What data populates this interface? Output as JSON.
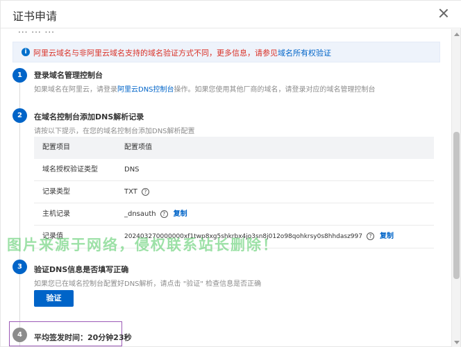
{
  "dialog": {
    "title": "证书申请"
  },
  "cut_text": "... ...    ...",
  "alert": {
    "text": "阿里云域名与非阿里云域名支持的域名验证方式不同，更多信息，请参见",
    "link": "域名所有权验证"
  },
  "steps": [
    {
      "num": "1",
      "title": "登录域名管理控制台",
      "desc_before": "如果域名在阿里云，请登录",
      "desc_link": "阿里云DNS控制台",
      "desc_after": "操作。如果您使用其他厂商的域名，请登录对应的域名管理控制台"
    },
    {
      "num": "2",
      "title": "在域名控制台添加DNS解析记录",
      "desc": "请按以下提示，在您的域名控制台添加DNS解析配置"
    },
    {
      "num": "3",
      "title": "验证DNS信息是否填写正确",
      "desc": "如果您已在域名控制台配置好DNS解析，请点击 \"验证\" 检查信息是否正确",
      "button": "验证"
    },
    {
      "num": "4",
      "title": "平均签发时间：20分钟23秒"
    }
  ],
  "table": {
    "headers": [
      "配置项目",
      "配置项值"
    ],
    "rows": [
      {
        "label": "域名授权验证类型",
        "value": "DNS"
      },
      {
        "label": "记录类型",
        "value": "TXT"
      },
      {
        "label": "主机记录",
        "value": "_dnsauth",
        "copy": "复制"
      },
      {
        "label": "记录值",
        "value": "202403270000000xf1twp8xg5shkrbx4jo3sn8j012o98qohkrsy0s8hhdasz997",
        "copy": "复制"
      }
    ]
  },
  "watermark": "图片来源于网络，侵权联系站长删除！",
  "colors": {
    "primary": "#0064c8",
    "alert_text": "#d93026",
    "alert_bg": "#eef3fb",
    "step_inactive": "#8c8c8c",
    "highlight": "#9b59b6",
    "watermark": "#4cc95e"
  },
  "icons": {
    "close": "close-icon",
    "info": "info-icon",
    "help": "question-circle-icon"
  }
}
